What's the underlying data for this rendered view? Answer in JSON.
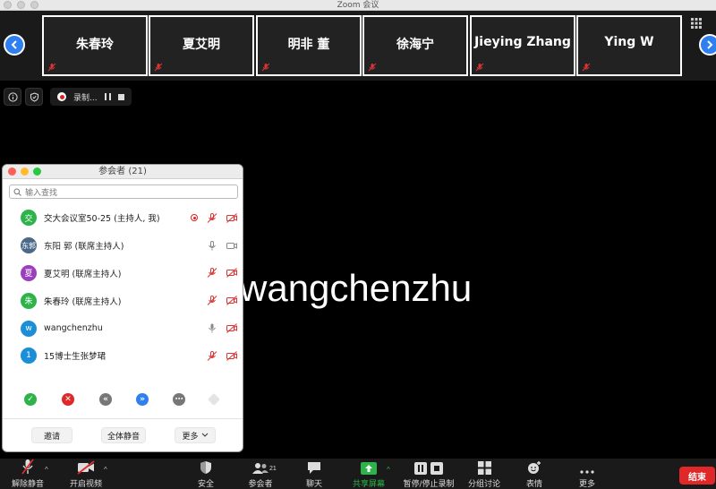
{
  "window": {
    "title": "Zoom 会议"
  },
  "video_strip": {
    "tiles": [
      {
        "name": "朱春玲"
      },
      {
        "name": "夏艾明"
      },
      {
        "name": "明非 董"
      },
      {
        "name": "徐海宁"
      },
      {
        "name": "Jieying Zhang"
      },
      {
        "name": "Ying W"
      }
    ]
  },
  "recording": {
    "label": "录制..."
  },
  "speaker": {
    "name": "wangchenzhu"
  },
  "participants_panel": {
    "title": "参会者 (21)",
    "search_placeholder": "输入查找",
    "participants": [
      {
        "avatar_text": "交",
        "avatar_color": "#2db34a",
        "name": "交大会议室50-25 (主持人, 我)"
      },
      {
        "avatar_text": "东郭",
        "avatar_color": "#4b6a8a",
        "name": "东阳 郭 (联席主持人)"
      },
      {
        "avatar_text": "夏",
        "avatar_color": "#9b3fbf",
        "name": "夏艾明 (联席主持人)"
      },
      {
        "avatar_text": "朱",
        "avatar_color": "#2db34a",
        "name": "朱春玲 (联席主持人)"
      },
      {
        "avatar_text": "w",
        "avatar_color": "#1a8fd8",
        "name": "wangchenzhu"
      },
      {
        "avatar_text": "1",
        "avatar_color": "#1a8fd8",
        "name": "15博士生张梦珺"
      }
    ],
    "buttons": {
      "invite": "邀请",
      "mute_all": "全体静音",
      "more": "更多"
    }
  },
  "toolbar": {
    "unmute": "解除静音",
    "start_video": "开启视频",
    "security": "安全",
    "participants": "参会者",
    "participants_count": "21",
    "chat": "聊天",
    "share_screen": "共享屏幕",
    "pause_stop_recording": "暂停/停止录制",
    "breakout": "分组讨论",
    "reactions": "表情",
    "more": "更多",
    "end": "结束"
  },
  "colors": {
    "accent_blue": "#2f7ff0",
    "share_green": "#2db34a",
    "end_red": "#e02828"
  }
}
